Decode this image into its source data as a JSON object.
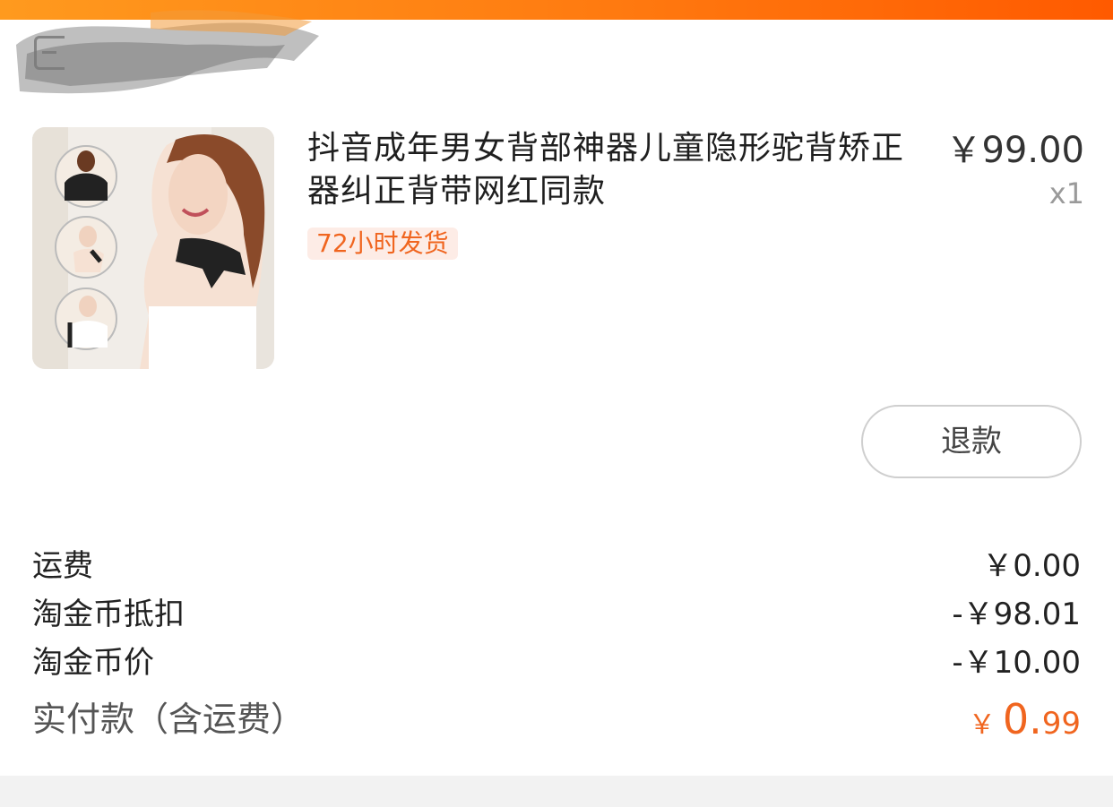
{
  "order": {
    "product": {
      "title": "抖音成年男女背部神器儿童隐形驼背矫正器纠正背带网红同款",
      "price": "￥99.00",
      "quantity": "x1",
      "ship_badge": "72小时发货",
      "thumb_icon": "posture-corrector-product-photo"
    },
    "refund_label": "退款",
    "summary": {
      "shipping_label": "运费",
      "shipping_value": "￥0.00",
      "coin_deduct_label": "淘金币抵扣",
      "coin_deduct_value": "-￥98.01",
      "coin_price_label": "淘金币价",
      "coin_price_value": "-￥10.00",
      "total_label": "实付款（含运费）",
      "total_currency": "￥",
      "total_int": "0.",
      "total_dec": "99"
    }
  },
  "colors": {
    "accent": "#f0651f",
    "top_bar": "#ff7a10",
    "badge_bg": "#fdece6"
  }
}
